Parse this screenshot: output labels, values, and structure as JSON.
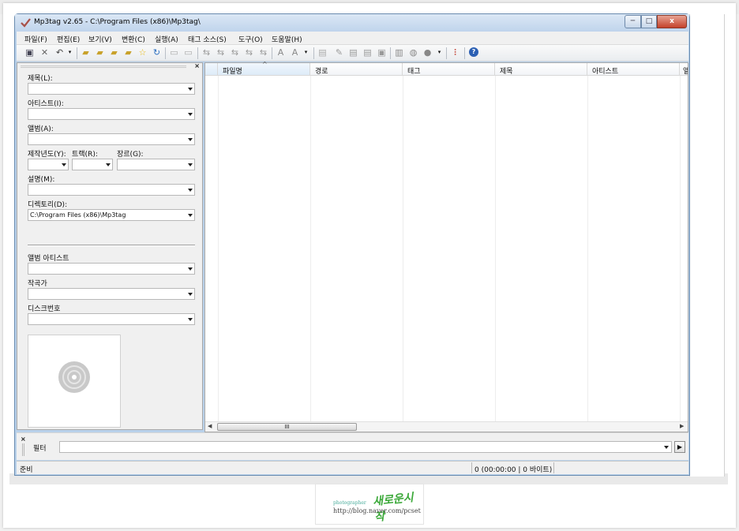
{
  "window": {
    "title": "Mp3tag v2.65  -  C:\\Program Files (x86)\\Mp3tag\\",
    "min": "─",
    "max": "□",
    "close": "x"
  },
  "menu": [
    "파일(F)",
    "편집(E)",
    "보기(V)",
    "변환(C)",
    "실행(A)",
    "태그 소스(S)",
    "도구(O)",
    "도움말(H)"
  ],
  "toolbar_icons": [
    "save-icon",
    "remove-tag-icon",
    "undo-icon",
    "dropdown-arrow-icon",
    "change-directory-icon",
    "add-directory-icon",
    "open-folder-icon",
    "favorites-folder-icon",
    "favorite-star-icon",
    "refresh-icon",
    "copy-tag-icon",
    "paste-tag-icon",
    "tag-filename-icon",
    "filename-tag-icon",
    "filename-filename-icon",
    "text-tag-icon",
    "tag-tag-icon",
    "case-convert-icon",
    "actions-icon",
    "actions-dropdown-icon",
    "export-icon",
    "edit-icon",
    "playlist-icon",
    "selected-playlist-icon",
    "select-all-icon",
    "freedb-icon",
    "web-icon",
    "web-dropdown-icon",
    "options-icon",
    "help-icon"
  ],
  "left_panel": {
    "close": "×",
    "title_label": "제목(L):",
    "artist_label": "아티스트(I):",
    "album_label": "앨범(A):",
    "year_label": "제작년도(Y):",
    "track_label": "트랙(R):",
    "genre_label": "장르(G):",
    "comment_label": "설명(M):",
    "directory_label": "디렉토리(D):",
    "directory_value": "C:\\Program Files (x86)\\Mp3tag",
    "album_artist_label": "앨범 아티스트",
    "composer_label": "작곡가",
    "disc_label": "디스크번호"
  },
  "grid": {
    "columns": [
      "파일명",
      "경로",
      "태그",
      "제목",
      "아티스트",
      "앨"
    ],
    "sort_indicator": "^",
    "scroll_grip": "III",
    "scroll_left": "◀",
    "scroll_right": "▶"
  },
  "filter": {
    "close": "×",
    "label": "필터",
    "go": "▶"
  },
  "status": {
    "left": "준비",
    "right": "0 (00:00:00 | 0 바이트)"
  },
  "watermark": {
    "photographer": "photographer",
    "brand": "새로운시작",
    "url": "http://blog.naver.com/pcset"
  }
}
